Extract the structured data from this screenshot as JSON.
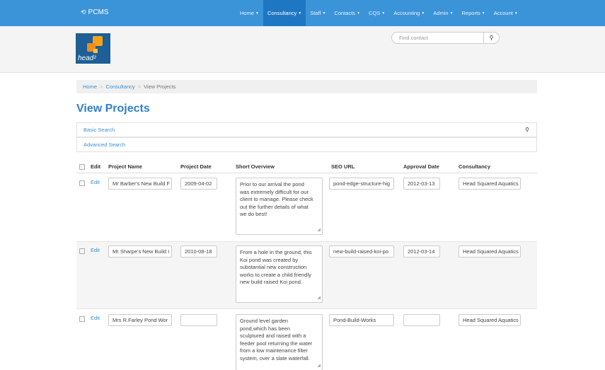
{
  "brand": {
    "name": "PCMS",
    "icon": "refresh-icon"
  },
  "nav": [
    {
      "label": "Home",
      "caret": true,
      "active": false
    },
    {
      "label": "Consultancy",
      "caret": true,
      "active": true
    },
    {
      "label": "Staff",
      "caret": true,
      "active": false
    },
    {
      "label": "Contacts",
      "caret": true,
      "active": false
    },
    {
      "label": "CQS",
      "caret": true,
      "active": false
    },
    {
      "label": "Accounting",
      "caret": true,
      "active": false
    },
    {
      "label": "Admin",
      "caret": true,
      "active": false
    },
    {
      "label": "Reports",
      "caret": true,
      "active": false
    },
    {
      "label": "Account",
      "caret": true,
      "active": false
    }
  ],
  "logo": {
    "text": "head²"
  },
  "search": {
    "placeholder": "Find contact",
    "value": ""
  },
  "breadcrumb": {
    "home": "Home",
    "section": "Consultancy",
    "current": "View Projects",
    "separator": ">"
  },
  "page_title": "View Projects",
  "basic_search": "Basic Search",
  "advanced_search": "Advanced Search",
  "table": {
    "columns": [
      "Edit",
      "Project Name",
      "Project Date",
      "Short Overview",
      "SEO URL",
      "Approval Date",
      "Consultancy"
    ],
    "rows": [
      {
        "edit": "Edit",
        "project_name": "Mr Barber's New Build F",
        "project_date": "2009-04-02",
        "overview_lines": [
          "Prior to our arrival the pond",
          "was extremely difficult for our",
          "client to manage. Please check",
          "out the further details of what",
          "we do best!"
        ],
        "seo_url": "pond-edge-structure-hig",
        "approval_date": "2012-03-13",
        "consultancy": "Head Squared Aquatics"
      },
      {
        "edit": "Edit",
        "project_name": "Mr Sharpe's New Build I",
        "project_date": "2010-08-18",
        "overview_lines": [
          "From a hole in the ground, this",
          "Koi pond was created by",
          "substantial new construction",
          "works to create a child friendly",
          "new build raised Koi pond."
        ],
        "seo_url": "new-build-raised-koi-po",
        "approval_date": "2012-03-14",
        "consultancy": "Head Squared Aquatics"
      },
      {
        "edit": "Edit",
        "project_name": "Mrs R.Farley Pond Wor",
        "project_date": "",
        "overview_lines": [
          "Ground level garden",
          "pond,which has been",
          "sculptured and raised with a",
          "feeder pool returning the water",
          "from a low maintenance filter",
          "system, over a slate waterfall."
        ],
        "seo_url": "Pond-Build-Works",
        "approval_date": "",
        "consultancy": "Head Squared Aquatics"
      }
    ]
  },
  "colors": {
    "navbar": "#3b93d8",
    "nav_active": "#1f77c3",
    "link": "#3b8fd0",
    "title": "#2f80c7"
  }
}
